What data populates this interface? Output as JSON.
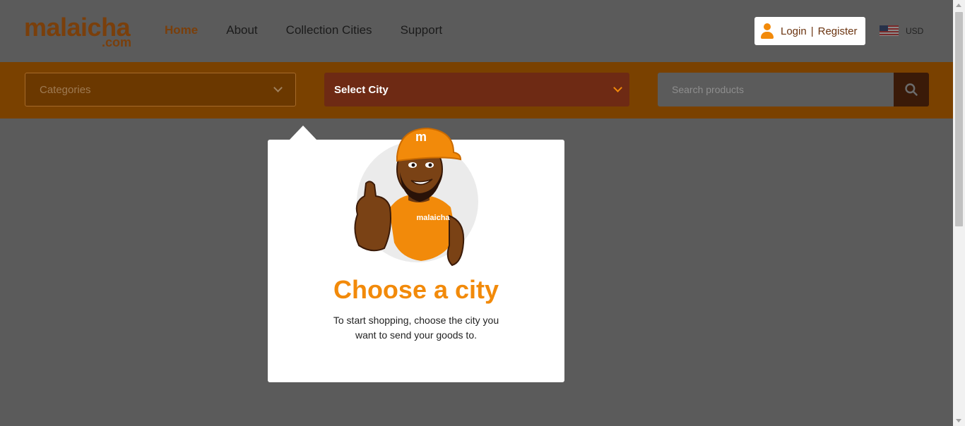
{
  "logo": {
    "main": "malaicha",
    "sub": ".com"
  },
  "nav": {
    "items": [
      {
        "label": "Home",
        "active": true
      },
      {
        "label": "About"
      },
      {
        "label": "Collection Cities"
      },
      {
        "label": "Support"
      }
    ]
  },
  "account": {
    "login": "Login",
    "separator": "|",
    "register": "Register",
    "icon": "user-icon"
  },
  "currency": {
    "code": "USD",
    "flag": "us-flag-icon"
  },
  "filters": {
    "categories_label": "Categories",
    "city_label": "Select City",
    "search_placeholder": "Search products"
  },
  "popup": {
    "mascot_shirt_text": "malaicha",
    "mascot_cap_letter": "m",
    "title": "Choose a city",
    "description": "To start shopping, choose the city you want to send your goods to."
  },
  "colors": {
    "brand_orange": "#f28a0a",
    "brand_brown": "#7a3f0b",
    "bar": "#7a4100",
    "city_select": "#6e2a14",
    "search_button": "#3a1a08"
  }
}
